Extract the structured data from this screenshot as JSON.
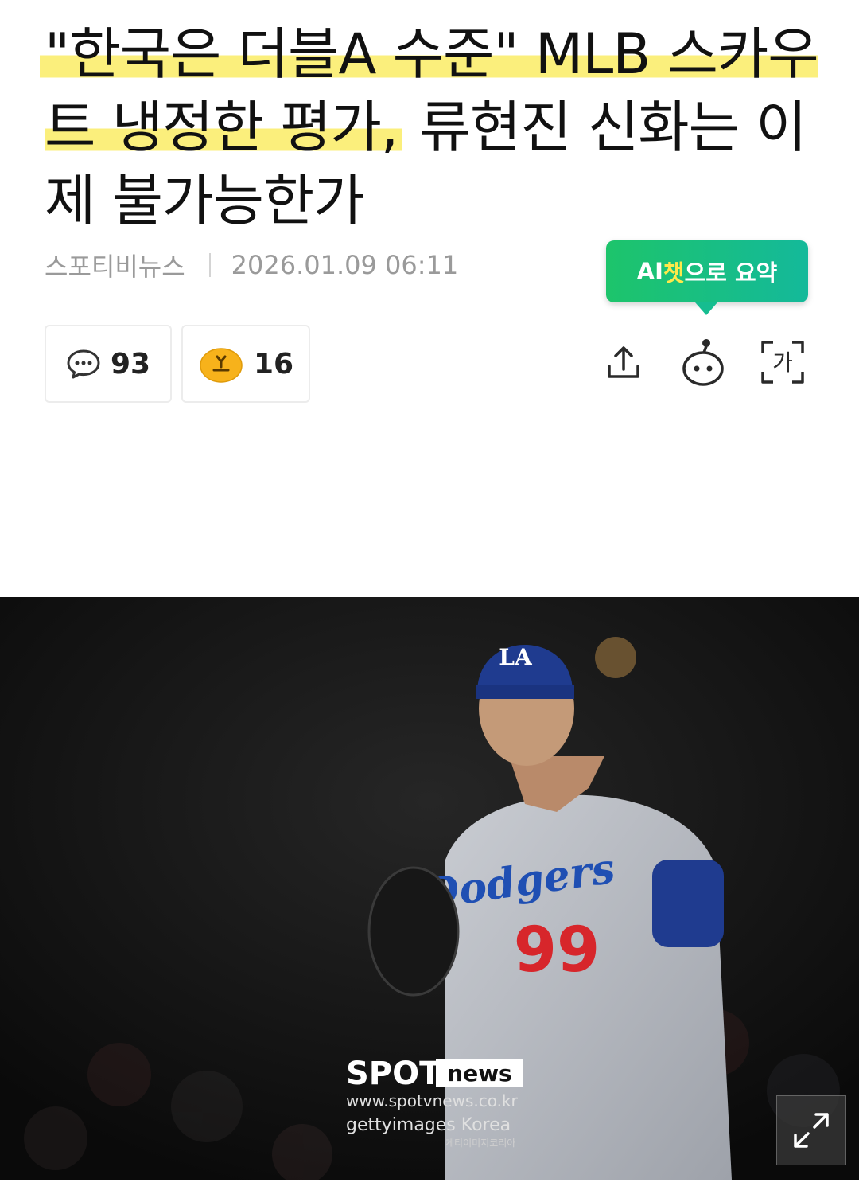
{
  "article": {
    "headline_part1": "\"한국은 더블A 수준\" MLB 스카우트 냉정한 평가,",
    "headline_part2": " 류현진 신화는 이제 불가능한가",
    "source": "스포티비뉴스",
    "datetime": "2026.01.09 06:11"
  },
  "ai_summary": {
    "label_prefix": "AI",
    "label_highlight": "챗",
    "label_suffix": "으로 요약"
  },
  "stats": {
    "comments": "93",
    "reactions": "16"
  },
  "toolbar": {
    "font_size_glyph": "가",
    "icons": [
      "share-icon",
      "bot-icon",
      "font-size-icon"
    ]
  },
  "photo": {
    "cap_logo": "LA",
    "jersey_text": "Dodgers",
    "jersey_number": "99",
    "watermark_brand": "SPOTV",
    "watermark_brand_suffix": "news",
    "watermark_url": "www.spotvnews.co.kr",
    "watermark_getty": "gettyimages Korea",
    "watermark_getty_ko": "게티이미지코리아"
  },
  "colors": {
    "highlight": "#fbef7c",
    "ai_green": "#1dc46b",
    "ai_yellow_text": "#ffe94a"
  }
}
